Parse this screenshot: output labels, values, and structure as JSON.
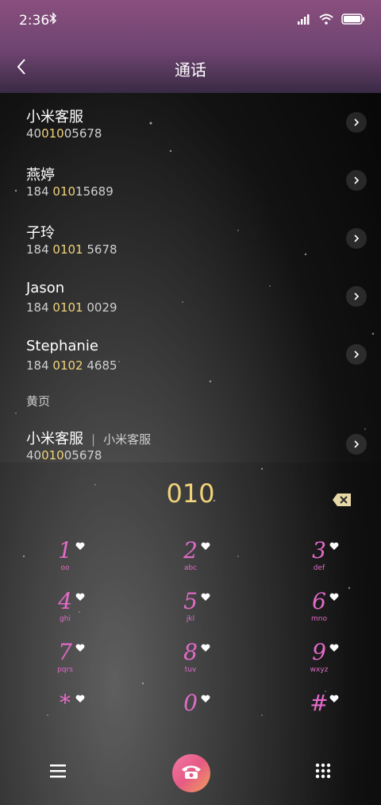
{
  "status": {
    "time": "2:36"
  },
  "header": {
    "title": "通话"
  },
  "results": [
    {
      "name": "小米客服",
      "num_pre": "40",
      "num_hl": "010",
      "num_post": "05678"
    },
    {
      "name": "燕婷",
      "num_pre": "184 ",
      "num_hl": "010",
      "num_post": "15689"
    },
    {
      "name": "子玲",
      "num_pre": "184 ",
      "num_hl": "0101",
      "num_post": " 5678"
    },
    {
      "name": "Jason",
      "num_pre": "184 ",
      "num_hl": "0101",
      "num_post": " 0029"
    },
    {
      "name": "Stephanie",
      "num_pre": "184 ",
      "num_hl": "0102",
      "num_post": " 4685"
    }
  ],
  "yellow_pages": {
    "section_label": "黄页",
    "item": {
      "name": "小米客服",
      "separator": "|",
      "sub": "小米客服",
      "num_pre": "40",
      "num_hl": "010",
      "num_post": "05678"
    }
  },
  "dialer": {
    "input": "010",
    "keys": [
      {
        "digit": "1",
        "letters": "oo"
      },
      {
        "digit": "2",
        "letters": "abc"
      },
      {
        "digit": "3",
        "letters": "def"
      },
      {
        "digit": "4",
        "letters": "ghi"
      },
      {
        "digit": "5",
        "letters": "jkl"
      },
      {
        "digit": "6",
        "letters": "mno"
      },
      {
        "digit": "7",
        "letters": "pqrs"
      },
      {
        "digit": "8",
        "letters": "tuv"
      },
      {
        "digit": "9",
        "letters": "wxyz"
      },
      {
        "digit": "*",
        "letters": ""
      },
      {
        "digit": "0",
        "letters": ""
      },
      {
        "digit": "#",
        "letters": ""
      }
    ]
  },
  "colors": {
    "highlight": "#f1d37a",
    "keypad": "#e36ac9",
    "header_top": "#8a4f7e"
  },
  "icons": {
    "back": "chevron-left-icon",
    "delete": "backspace-icon",
    "menu": "menu-icon",
    "call": "phone-icon",
    "dialpad": "dialpad-icon"
  }
}
